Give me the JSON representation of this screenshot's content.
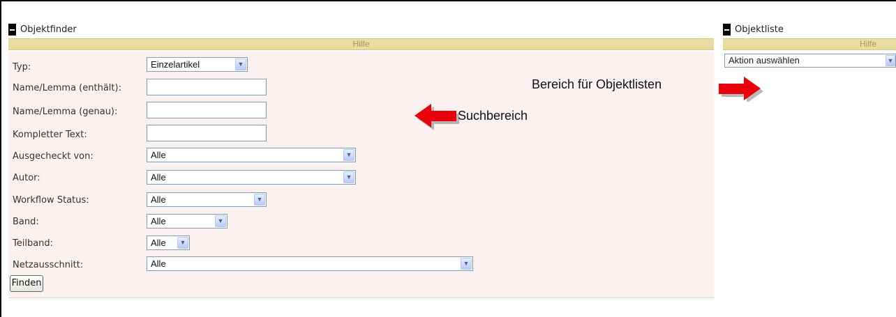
{
  "finder": {
    "title": "Objektfinder",
    "help": "Hilfe",
    "fields": [
      {
        "label": "Typ:",
        "type": "select",
        "value": "Einzelartikel"
      },
      {
        "label": "Name/Lemma (enthält):",
        "type": "text",
        "value": ""
      },
      {
        "label": "Name/Lemma (genau):",
        "type": "text",
        "value": ""
      },
      {
        "label": "Kompletter Text:",
        "type": "text",
        "value": ""
      },
      {
        "label": "Ausgecheckt von:",
        "type": "select",
        "value": "Alle"
      },
      {
        "label": "Autor:",
        "type": "select",
        "value": "Alle"
      },
      {
        "label": "Workflow Status:",
        "type": "select",
        "value": "Alle"
      },
      {
        "label": "Band:",
        "type": "select",
        "value": "Alle"
      },
      {
        "label": "Teilband:",
        "type": "select",
        "value": "Alle"
      },
      {
        "label": "Netzausschnitt:",
        "type": "select",
        "value": "Alle"
      }
    ],
    "find_button": "Finden"
  },
  "list": {
    "title": "Objektliste",
    "help": "Hilfe",
    "action_select": "Aktion auswählen"
  },
  "annotations": {
    "search_area": "Suchbereich",
    "list_area": "Bereich für Objektlisten"
  },
  "colors": {
    "help_bar": "#e9dc9f",
    "form_background": "#fbf1f1",
    "arrow": "#e8000b"
  },
  "icons": [
    "collapse-icon",
    "chevron-down-icon",
    "red-arrow-left-icon",
    "red-arrow-right-icon"
  ]
}
